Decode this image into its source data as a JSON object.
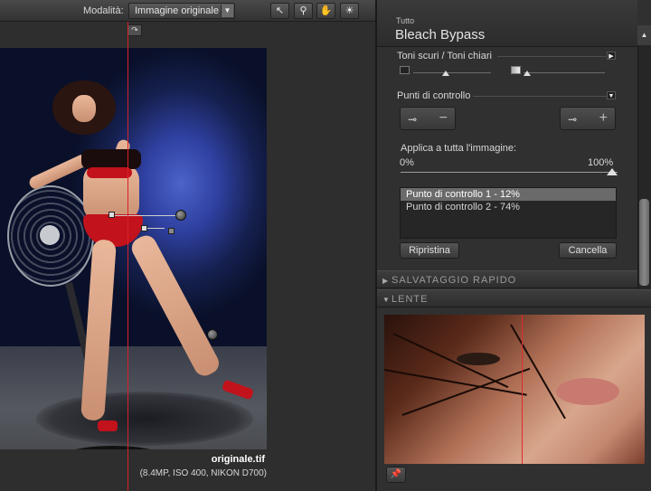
{
  "toolbar": {
    "mode_label": "Modalità:",
    "mode_value": "Immagine originale",
    "tools": [
      {
        "icon": "pointer-icon",
        "glyph": "↖"
      },
      {
        "icon": "zoom-icon",
        "glyph": "⚲"
      },
      {
        "icon": "hand-icon",
        "glyph": "✋"
      },
      {
        "icon": "lightbulb-icon",
        "glyph": "☀"
      }
    ],
    "rotate_glyph": "↷"
  },
  "preview": {
    "filename": "originale.tif",
    "fileinfo": "(8.4MP, ISO 400, NIKON D700)"
  },
  "panel": {
    "filter_category": "Tutto",
    "filter_name": "Bleach Bypass",
    "tones_section": "Toni scuri / Toni chiari",
    "control_points_section": "Punti di controllo",
    "apply_label": "Applica a tutta l'immagine:",
    "apply_min": "0%",
    "apply_max": "100%",
    "control_points": [
      {
        "label": "Punto di controllo 1 - 12%",
        "selected": true
      },
      {
        "label": "Punto di controllo 2 - 74%",
        "selected": false
      }
    ],
    "reset_button": "Ripristina",
    "delete_button": "Cancella",
    "quick_save_section": "SALVATAGGIO RAPIDO",
    "loupe_section": "LENTE"
  },
  "colors": {
    "split_line": "#d8212a",
    "selection": "#6a6a6a",
    "background": "#303030"
  }
}
